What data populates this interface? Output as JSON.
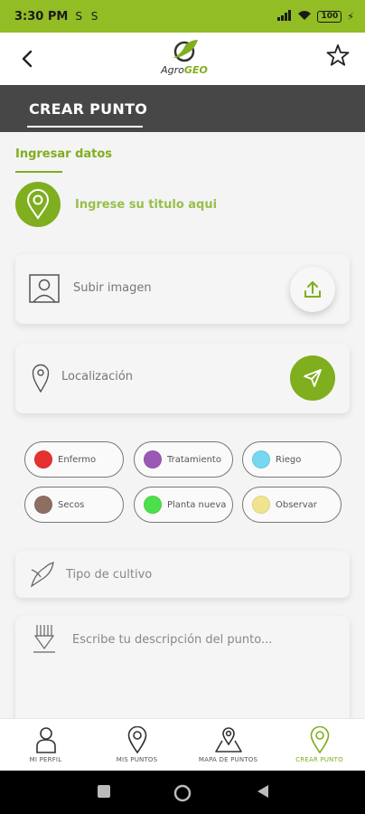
{
  "status_bar": {
    "time": "3:30 PM",
    "left_icons": "S S",
    "battery": "100"
  },
  "header": {
    "logo_prefix": "Agro",
    "logo_suffix": "GEO"
  },
  "title_bar": {
    "title": "CREAR PUNTO"
  },
  "form": {
    "section_label": "Ingresar datos",
    "title_placeholder": "Ingrese su titulo aqui",
    "image_label": "Subir imagen",
    "location_label": "Localización",
    "cultivo_placeholder": "Tipo de cultivo",
    "description_placeholder": "Escribe tu descripción del punto..."
  },
  "chips": [
    {
      "label": "Enfermo",
      "color": "#e63131"
    },
    {
      "label": "Tratamiento",
      "color": "#9b59b6"
    },
    {
      "label": "Riego",
      "color": "#76d7f0"
    },
    {
      "label": "Secos",
      "color": "#8d6e63"
    },
    {
      "label": "Planta nueva",
      "color": "#4be04b"
    },
    {
      "label": "Observar",
      "color": "#f1e48e"
    }
  ],
  "bottom_nav": [
    {
      "label": "MI PERFIL",
      "icon": "person-icon",
      "active": false
    },
    {
      "label": "MIS PUNTOS",
      "icon": "location-pin-icon",
      "active": false
    },
    {
      "label": "MAPA DE PUNTOS",
      "icon": "map-icon",
      "active": false
    },
    {
      "label": "CREAR PUNTO",
      "icon": "location-pin-icon",
      "active": true
    }
  ],
  "colors": {
    "accent": "#7fae1e",
    "status_bar": "#93bd24",
    "title_bar": "#474747"
  }
}
